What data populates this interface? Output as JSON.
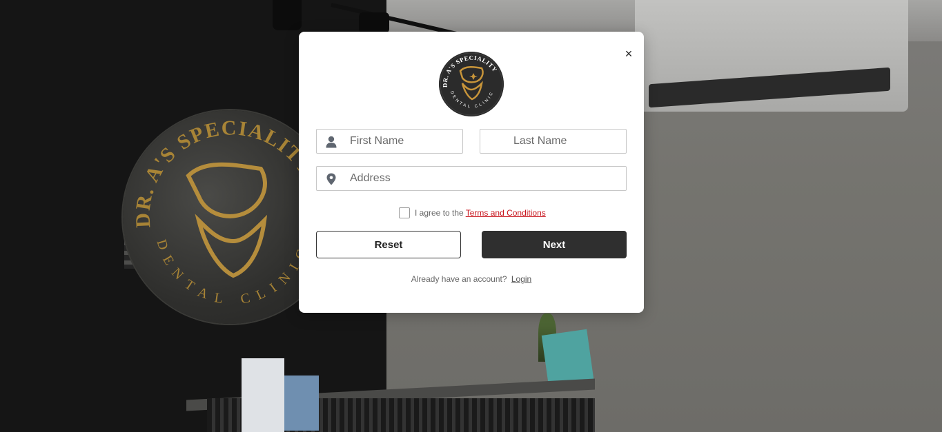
{
  "clinic": {
    "logo_top_text": "DR. A'S SPECIALITY",
    "logo_bottom_text": "DENTAL CLINIC"
  },
  "background_sign": {
    "top_text": "DR. A'S SPECIALITY",
    "bottom_text": "DENTAL CLINIC"
  },
  "modal": {
    "close_label": "×",
    "first_name_placeholder": "First Name",
    "last_name_placeholder": "Last Name",
    "address_placeholder": "Address",
    "agree_text": "I agree to the",
    "terms_link": "Terms and Conditions",
    "reset_label": "Reset",
    "next_label": "Next",
    "login_prompt": "Already have an account?",
    "login_link": "Login"
  },
  "colors": {
    "accent_link": "#c8141c",
    "primary_button": "#2f2f2f",
    "logo_gold": "#c8953a"
  },
  "icons": [
    "person-icon",
    "location-pin-icon",
    "close-icon",
    "tooth-logo-icon"
  ]
}
